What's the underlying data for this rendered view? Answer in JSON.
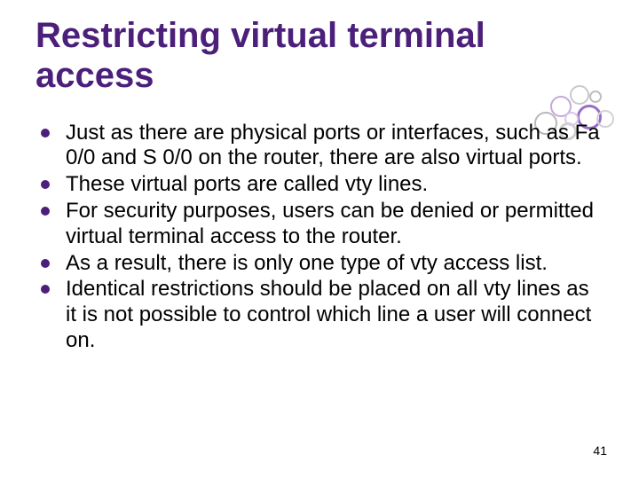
{
  "title": "Restricting virtual terminal access",
  "bullets": [
    "Just as there are physical ports or interfaces, such as Fa 0/0 and S 0/0 on the router, there are also virtual ports.",
    "These virtual ports are called vty lines.",
    "For security purposes, users can be denied or permitted virtual terminal access to the router.",
    "As a result, there is only one type of vty access list.",
    "Identical restrictions should be placed on all vty lines as it is not possible to control which line a user will connect on."
  ],
  "page_number": "41"
}
